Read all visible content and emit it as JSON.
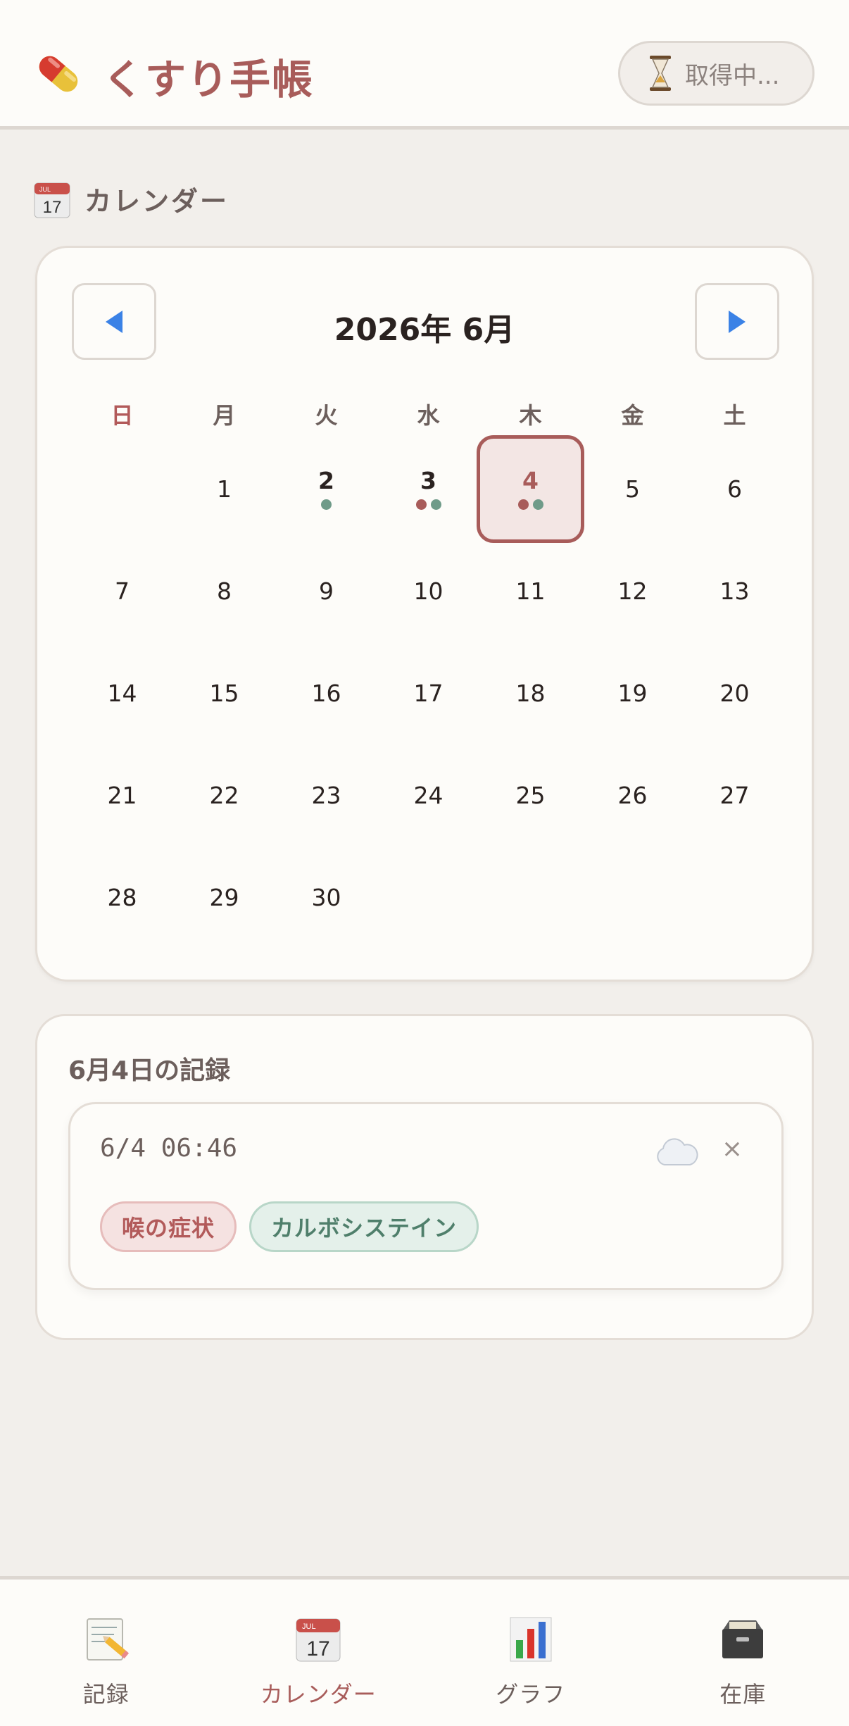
{
  "header": {
    "title": "くすり手帳",
    "logo_icon": "pill-icon",
    "status_icon": "hourglass-icon",
    "status_text": "取得中..."
  },
  "section": {
    "icon": "calendar-icon",
    "title": "カレンダー"
  },
  "calendar": {
    "month_title": "2026年 6月",
    "prev_icon": "chevron-left-icon",
    "next_icon": "chevron-right-icon",
    "weekdays": [
      "日",
      "月",
      "火",
      "水",
      "木",
      "金",
      "土"
    ],
    "leading_blanks": 1,
    "days": [
      {
        "d": "1"
      },
      {
        "d": "2",
        "dots": [
          "green"
        ]
      },
      {
        "d": "3",
        "dots": [
          "red",
          "green"
        ]
      },
      {
        "d": "4",
        "dots": [
          "red",
          "green"
        ],
        "selected": true
      },
      {
        "d": "5"
      },
      {
        "d": "6"
      },
      {
        "d": "7"
      },
      {
        "d": "8"
      },
      {
        "d": "9"
      },
      {
        "d": "10"
      },
      {
        "d": "11"
      },
      {
        "d": "12"
      },
      {
        "d": "13"
      },
      {
        "d": "14"
      },
      {
        "d": "15"
      },
      {
        "d": "16"
      },
      {
        "d": "17"
      },
      {
        "d": "18"
      },
      {
        "d": "19"
      },
      {
        "d": "20"
      },
      {
        "d": "21"
      },
      {
        "d": "22"
      },
      {
        "d": "23"
      },
      {
        "d": "24"
      },
      {
        "d": "25"
      },
      {
        "d": "26"
      },
      {
        "d": "27"
      },
      {
        "d": "28"
      },
      {
        "d": "29"
      },
      {
        "d": "30"
      }
    ]
  },
  "records": {
    "title": "6月4日の記録",
    "entries": [
      {
        "time": "6/4 06:46",
        "weather_icon": "cloud-icon",
        "close_label": "×",
        "tags": [
          {
            "label": "喉の症状",
            "kind": "red"
          },
          {
            "label": "カルボシステイン",
            "kind": "green"
          }
        ]
      }
    ]
  },
  "bottom_nav": [
    {
      "label": "記録",
      "icon": "memo-icon",
      "active": false
    },
    {
      "label": "カレンダー",
      "icon": "calendar-icon",
      "active": true
    },
    {
      "label": "グラフ",
      "icon": "bar-chart-icon",
      "active": false
    },
    {
      "label": "在庫",
      "icon": "file-cabinet-icon",
      "active": false
    }
  ],
  "colors": {
    "accent": "#a85c5a",
    "green": "#6f9b89",
    "background": "#f2efeb",
    "card": "#fdfcf9"
  }
}
